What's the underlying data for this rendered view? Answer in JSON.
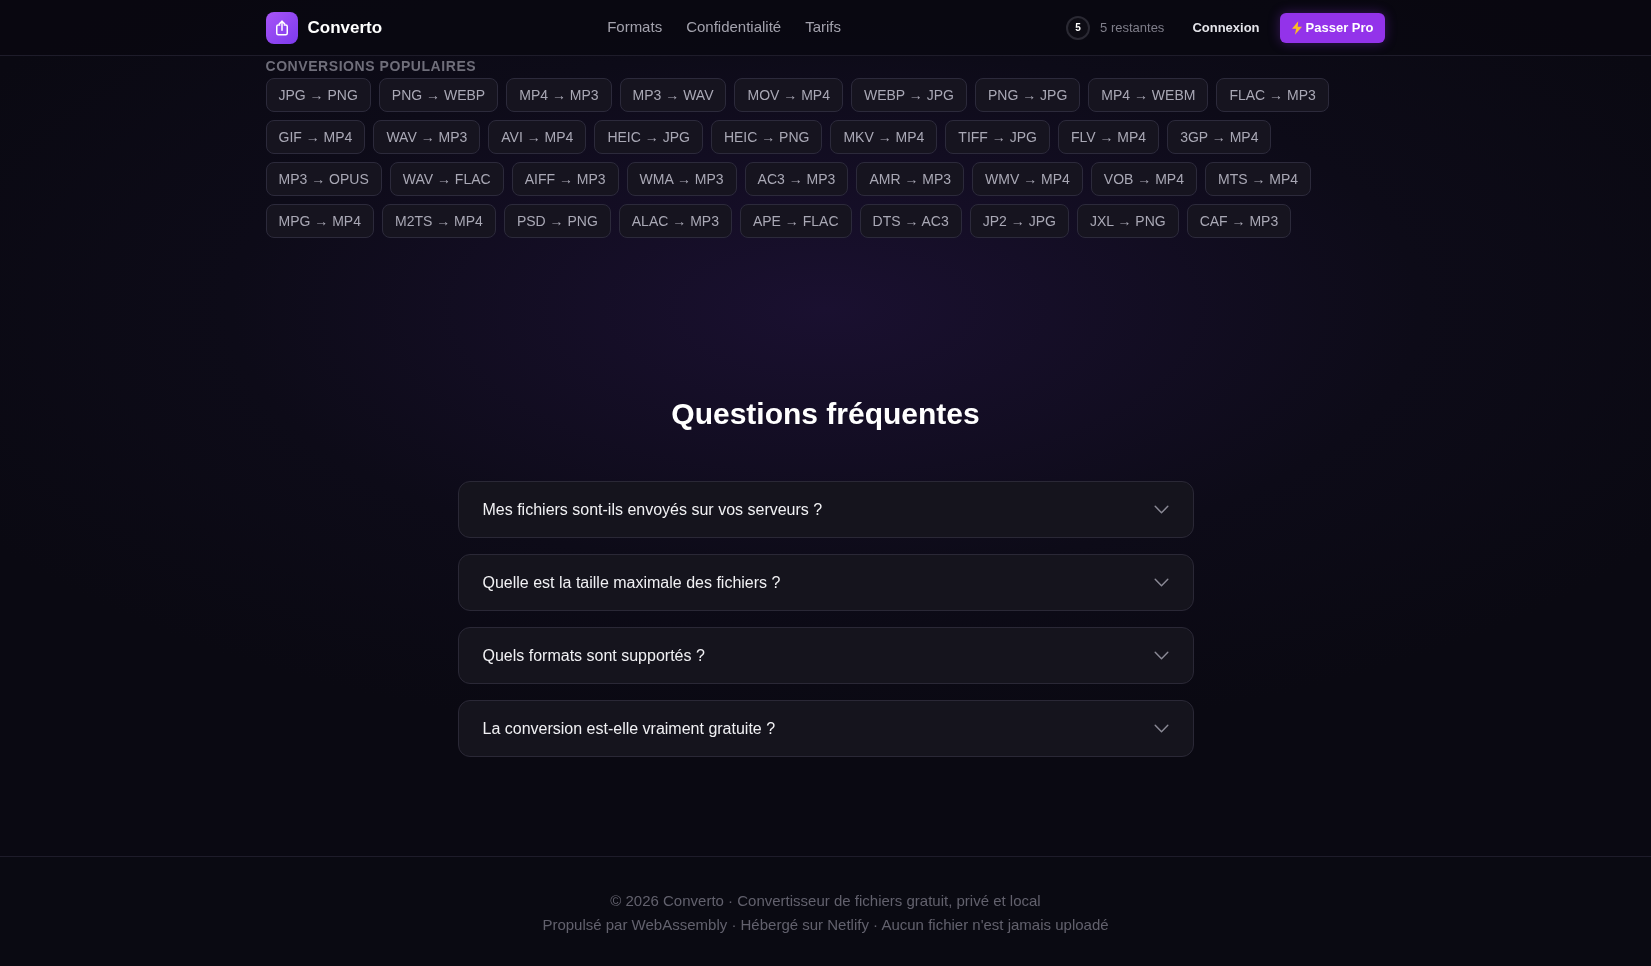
{
  "header": {
    "brand": "Converto",
    "nav": [
      {
        "label": "Formats"
      },
      {
        "label": "Confidentialité"
      },
      {
        "label": "Tarifs"
      }
    ],
    "credits": {
      "count": "5",
      "label": "5 restantes"
    },
    "login": "Connexion",
    "upgrade": "Passer Pro"
  },
  "popular": {
    "title": "CONVERSIONS POPULAIRES",
    "conversions": [
      "JPG → PNG",
      "PNG → WEBP",
      "MP4 → MP3",
      "MP3 → WAV",
      "MOV → MP4",
      "WEBP → JPG",
      "PNG → JPG",
      "MP4 → WEBM",
      "FLAC → MP3",
      "GIF → MP4",
      "WAV → MP3",
      "AVI → MP4",
      "HEIC → JPG",
      "HEIC → PNG",
      "MKV → MP4",
      "TIFF → JPG",
      "FLV → MP4",
      "3GP → MP4",
      "MP3 → OPUS",
      "WAV → FLAC",
      "AIFF → MP3",
      "WMA → MP3",
      "AC3 → MP3",
      "AMR → MP3",
      "WMV → MP4",
      "VOB → MP4",
      "MTS → MP4",
      "MPG → MP4",
      "M2TS → MP4",
      "PSD → PNG",
      "ALAC → MP3",
      "APE → FLAC",
      "DTS → AC3",
      "JP2 → JPG",
      "JXL → PNG",
      "CAF → MP3"
    ]
  },
  "faq": {
    "title": "Questions fréquentes",
    "items": [
      {
        "question": "Mes fichiers sont-ils envoyés sur vos serveurs ?",
        "expanded": false
      },
      {
        "question": "Quelle est la taille maximale des fichiers ?",
        "expanded": false
      },
      {
        "question": "Quels formats sont supportés ?",
        "expanded": false
      },
      {
        "question": "La conversion est-elle vraiment gratuite ?",
        "expanded": false
      }
    ]
  },
  "footer": {
    "lines": [
      "© 2026 Converto · Convertisseur de fichiers gratuit, privé et local",
      "Propulsé par WebAssembly · Hébergé sur Netlify · Aucun fichier n'est jamais uploadé"
    ]
  }
}
